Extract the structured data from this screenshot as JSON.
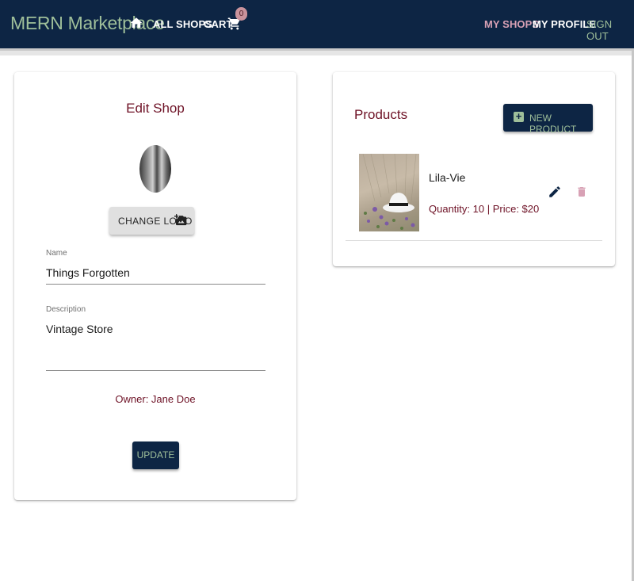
{
  "appbar": {
    "brand": "MERN Marketplace",
    "icons": {
      "home": "home-icon",
      "cart": "cart-icon"
    },
    "links": {
      "all_shops": "ALL SHOPS",
      "cart": "CART",
      "my_shops": "MY SHOPS",
      "my_profile": "MY PROFILE",
      "sign_out": "SIGN OUT"
    },
    "cart_count": "0"
  },
  "edit_shop": {
    "title": "Edit Shop",
    "change_logo_label": "CHANGE LOGO",
    "name": {
      "label": "Name",
      "value": "Things Forgotten"
    },
    "description": {
      "label": "Description",
      "value": "Vintage Store"
    },
    "owner": "Owner: Jane Doe",
    "update_label": "UPDATE"
  },
  "products": {
    "title": "Products",
    "new_product_label": "NEW PRODUCT",
    "items": [
      {
        "name": "Lila-Vie",
        "meta": "Quantity: 10 | Price: $20"
      }
    ]
  },
  "colors": {
    "navy": "#0d2544",
    "sage": "#9fbf9a",
    "maroon": "#6e1226",
    "pink": "#d8a1b5",
    "badge": "#c9939c"
  }
}
